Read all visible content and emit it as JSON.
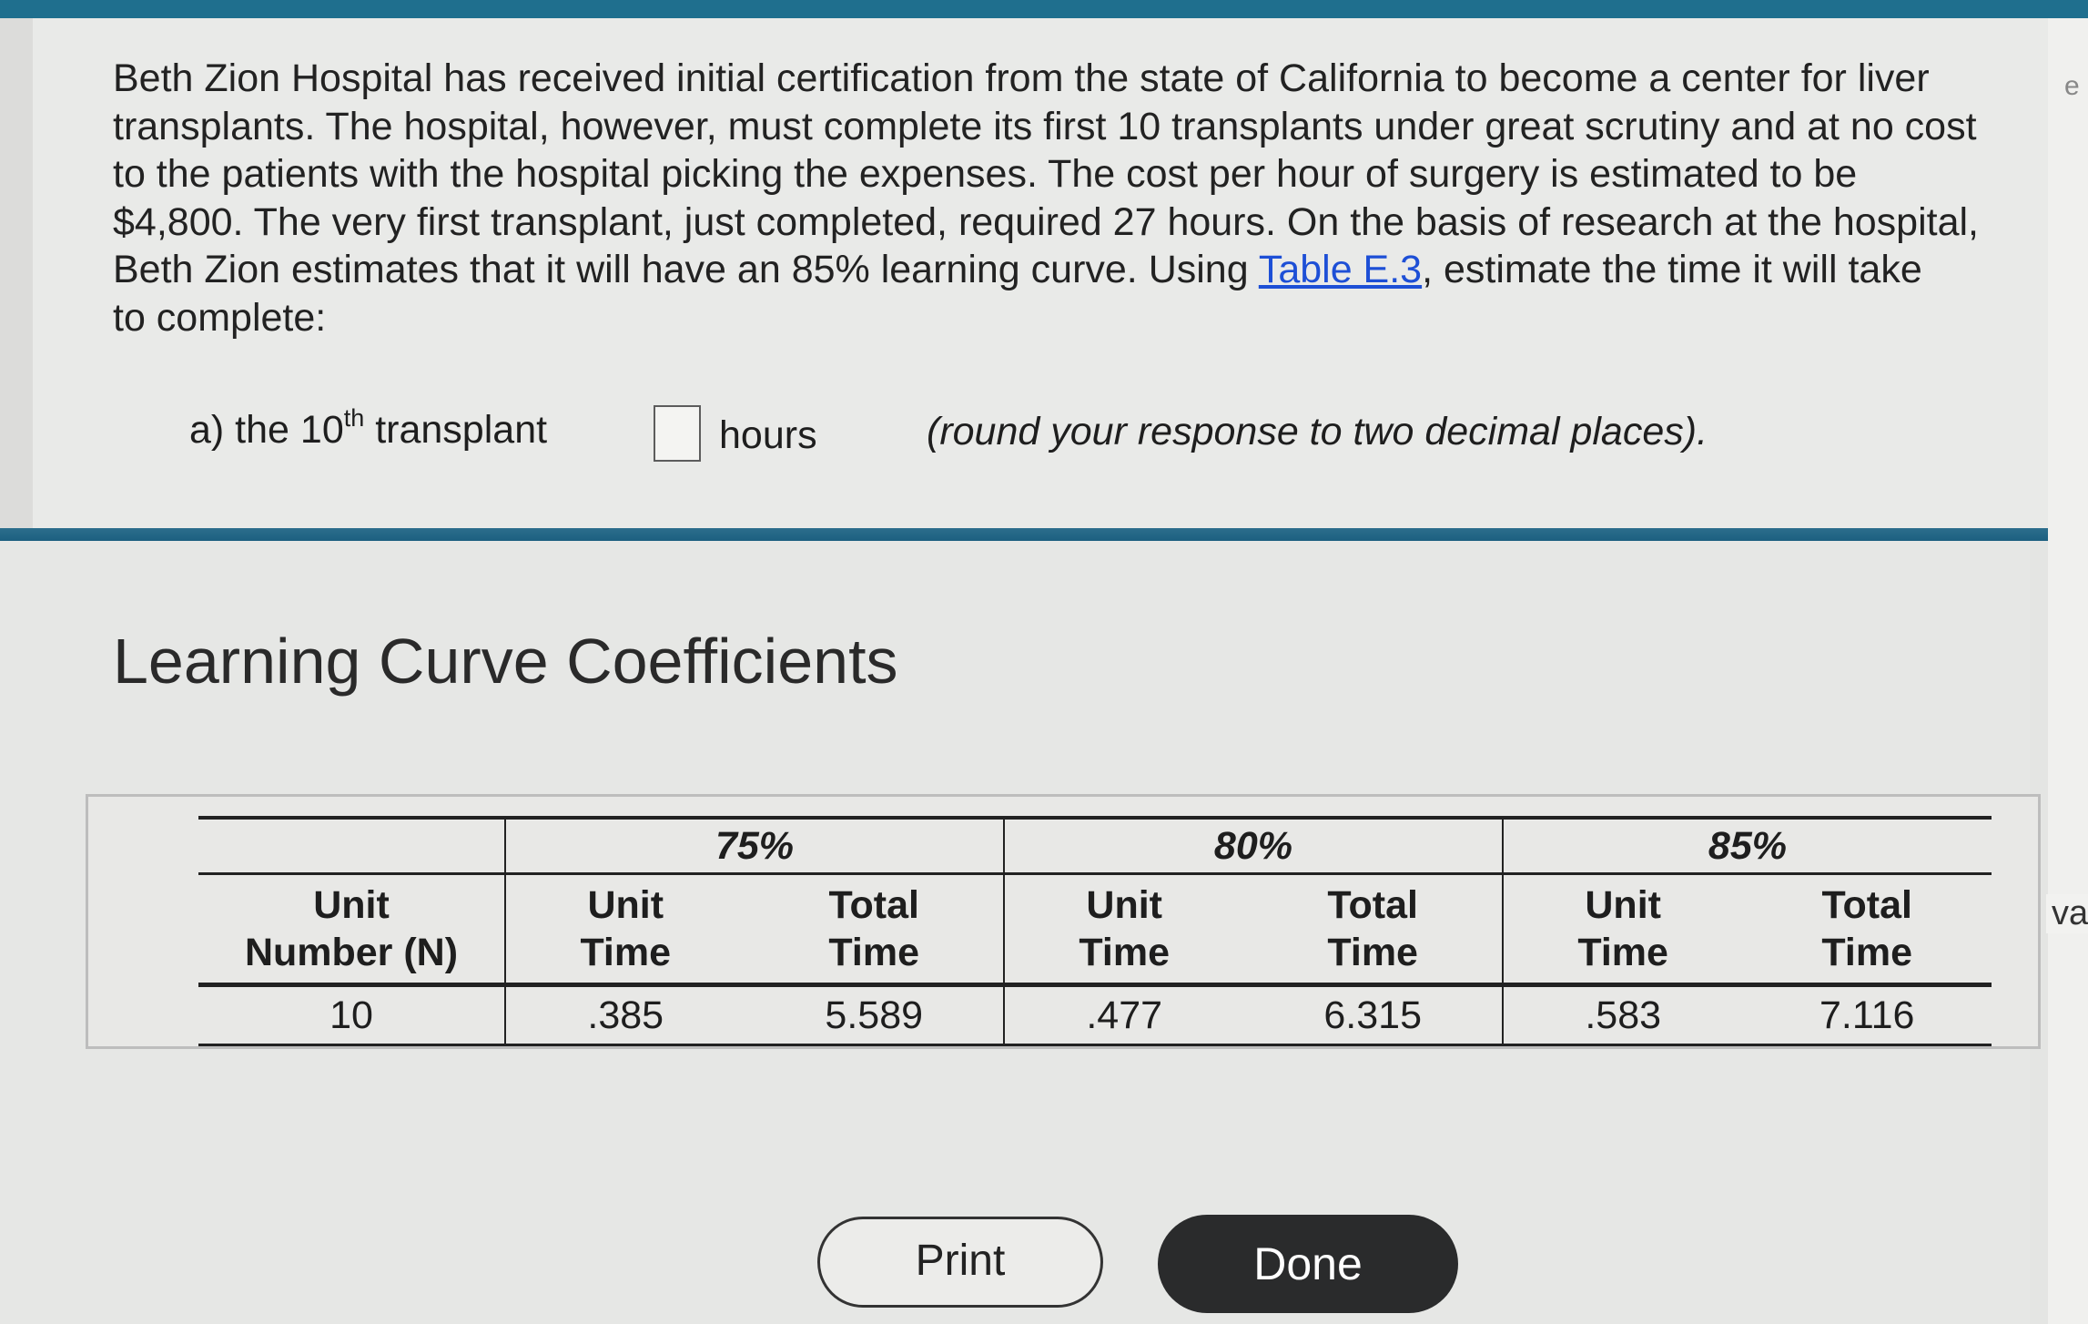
{
  "question": {
    "line1": "Beth Zion Hospital has received initial certification from the state of California to become a center for liver",
    "line2": "transplants.  The hospital, however, must complete its first 10 transplants under great scrutiny and at no cost",
    "line3": "to the patients with the hospital picking the expenses.  The cost per hour of surgery is estimated to be",
    "line4": "$4,800.  The very first transplant, just completed, required 27 hours. On the basis of research at the hospital,",
    "line5_before": "Beth Zion estimates that it will have an 85% learning curve. Using ",
    "link": "Table E.3",
    "line5_after": ", estimate the time it will take",
    "line6": "to complete:"
  },
  "part_a": {
    "prefix": "a) the 10",
    "superscript": "th",
    "suffix": " transplant",
    "answer_value": "",
    "unit": "hours",
    "instruction": "(round your response to two decimal places)."
  },
  "edge": {
    "e": "e",
    "va": "va"
  },
  "popup": {
    "title": "Learning Curve Coefficients",
    "table": {
      "percents": [
        "75%",
        "80%",
        "85%"
      ],
      "first_col_header": [
        "Unit",
        "Number (N)"
      ],
      "unit_time_header": [
        "Unit",
        "Time"
      ],
      "total_time_header": [
        "Total",
        "Time"
      ],
      "row": [
        "10",
        ".385",
        "5.589",
        ".477",
        "6.315",
        ".583",
        "7.116"
      ]
    },
    "print_label": "Print",
    "done_label": "Done"
  }
}
